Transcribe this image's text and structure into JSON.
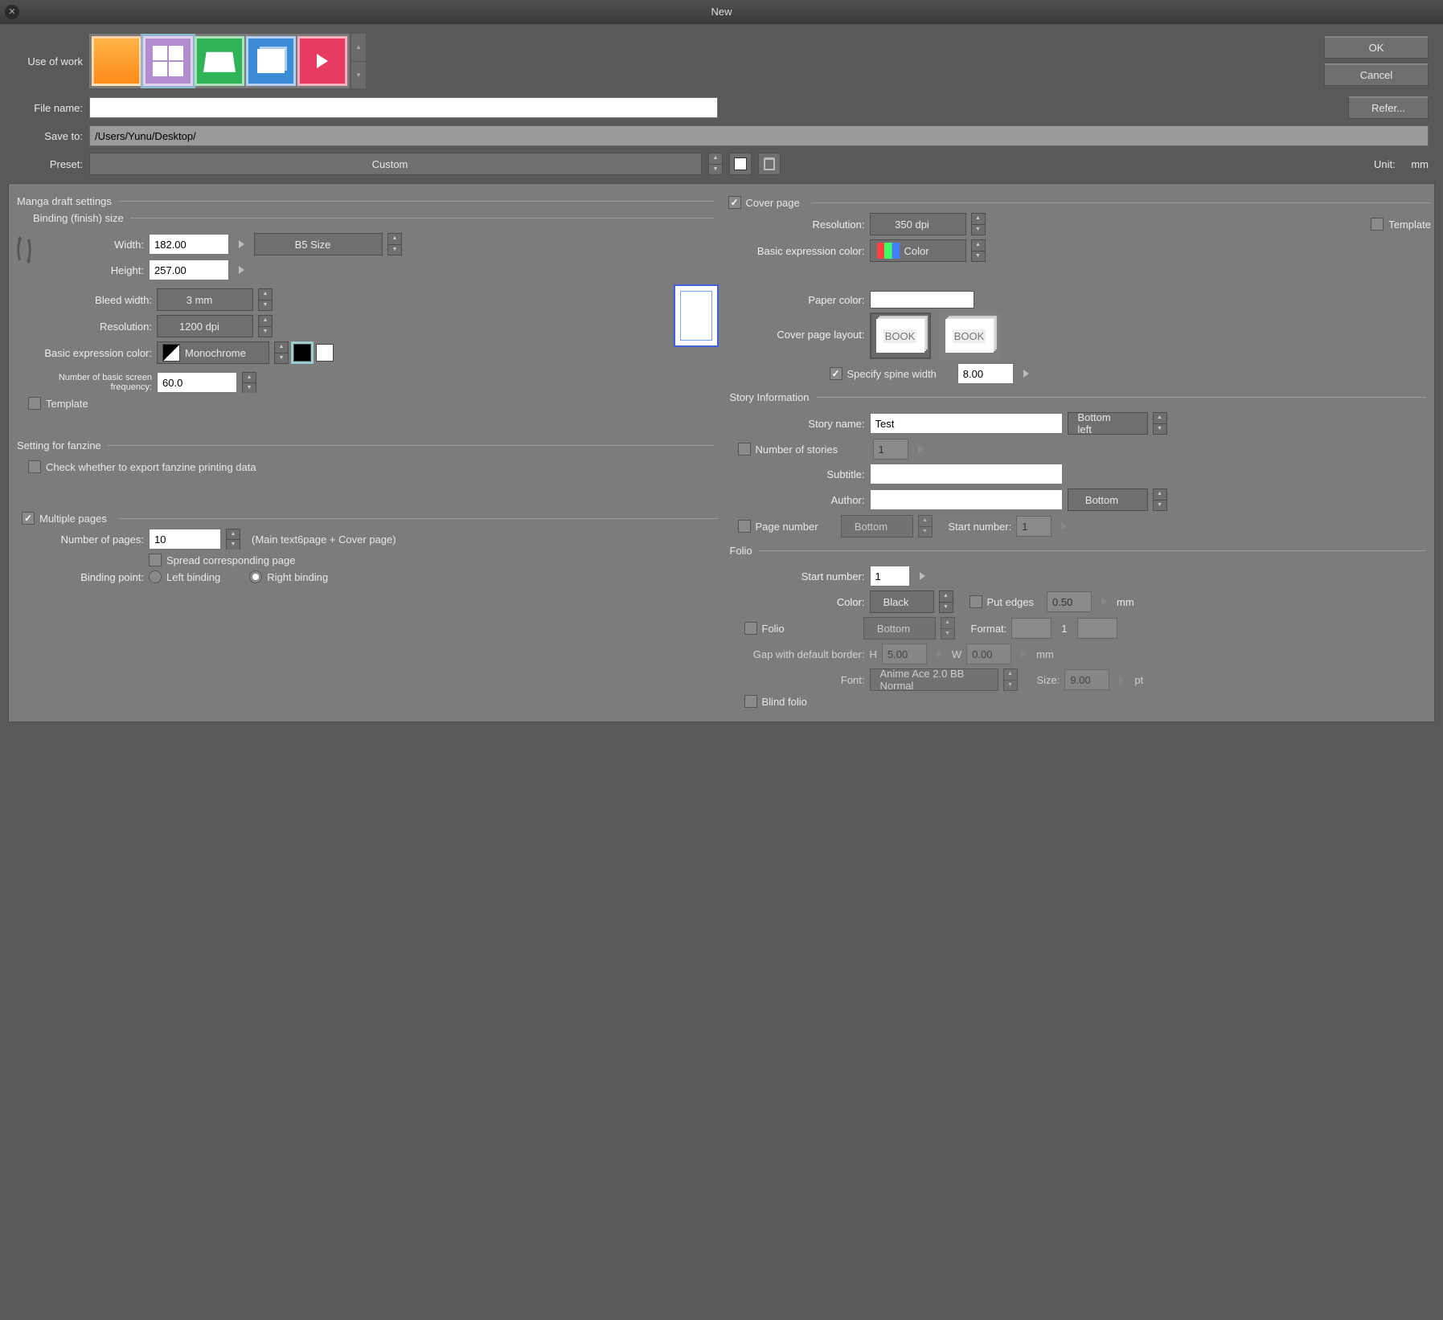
{
  "title": "New",
  "buttons": {
    "ok": "OK",
    "cancel": "Cancel",
    "refer": "Refer..."
  },
  "use_of_work_label": "Use of work",
  "file_name": {
    "label": "File name:",
    "value": ""
  },
  "save_to": {
    "label": "Save to:",
    "value": "/Users/Yunu/Desktop/"
  },
  "preset": {
    "label": "Preset:",
    "value": "Custom"
  },
  "unit": {
    "label": "Unit:",
    "value": "mm"
  },
  "mds": {
    "title": "Manga draft settings",
    "binding_title": "Binding (finish) size",
    "width": {
      "label": "Width:",
      "value": "182.00"
    },
    "height": {
      "label": "Height:",
      "value": "257.00"
    },
    "preset_size": "B5 Size",
    "bleed": {
      "label": "Bleed width:",
      "value": "3 mm"
    },
    "resolution": {
      "label": "Resolution:",
      "value": "1200 dpi"
    },
    "bec": {
      "label": "Basic expression color:",
      "value": "Monochrome"
    },
    "freq": {
      "label": "Number of basic screen frequency:",
      "value": "60.0"
    },
    "template_label": "Template"
  },
  "fanzine": {
    "title": "Setting for fanzine",
    "check": "Check whether to export fanzine printing data"
  },
  "multi": {
    "label": "Multiple pages",
    "pages": {
      "label": "Number of pages:",
      "value": "10",
      "note": "(Main text6page + Cover page)"
    },
    "spread": "Spread corresponding page",
    "binding_point": {
      "label": "Binding point:",
      "left": "Left binding",
      "right": "Right binding"
    }
  },
  "cover": {
    "label": "Cover page",
    "resolution": {
      "label": "Resolution:",
      "value": "350 dpi"
    },
    "template_label": "Template",
    "bec": {
      "label": "Basic expression color:",
      "value": "Color"
    },
    "paper_color": "Paper color:",
    "layout_label": "Cover page layout:",
    "spine": {
      "check": "Specify spine width",
      "value": "8.00"
    }
  },
  "story": {
    "title": "Story Information",
    "name": {
      "label": "Story name:",
      "value": "Test"
    },
    "name_pos": "Bottom left",
    "num_stories": {
      "label": "Number of stories",
      "value": "1"
    },
    "subtitle": {
      "label": "Subtitle:",
      "value": ""
    },
    "author": {
      "label": "Author:",
      "value": ""
    },
    "author_pos": "Bottom",
    "page_num": {
      "label": "Page number",
      "pos": "Bottom",
      "start_label": "Start number:",
      "start": "1"
    }
  },
  "folio": {
    "title": "Folio",
    "start": {
      "label": "Start number:",
      "value": "1"
    },
    "color": {
      "label": "Color:",
      "value": "Black"
    },
    "edges": {
      "label": "Put edges",
      "value": "0.50",
      "unit": "mm"
    },
    "folio_check": "Folio",
    "folio_pos": "Bottom",
    "format": {
      "label": "Format:",
      "mid": "1"
    },
    "gap": {
      "label": "Gap with default border:",
      "h_lbl": "H",
      "h": "5.00",
      "w_lbl": "W",
      "w": "0.00",
      "unit": "mm"
    },
    "font": {
      "label": "Font:",
      "value": "Anime Ace 2.0 BB Normal"
    },
    "size": {
      "label": "Size:",
      "value": "9.00",
      "unit": "pt"
    },
    "blind": "Blind folio"
  }
}
